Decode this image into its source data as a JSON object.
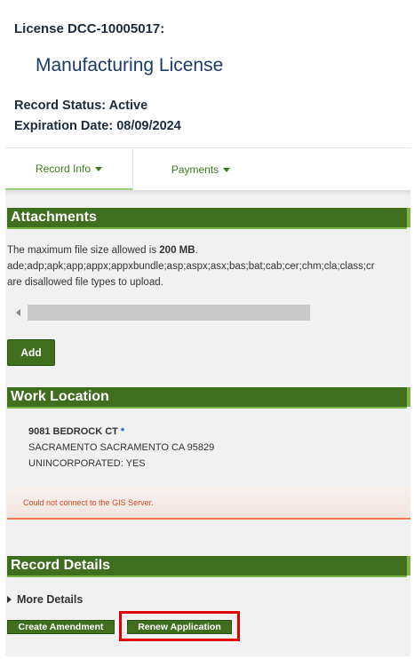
{
  "header": {
    "license_number": "License DCC-10005017:",
    "license_type": "Manufacturing License",
    "record_status": "Record Status: Active",
    "expiration_date": "Expiration Date: 08/09/2024"
  },
  "tabs": [
    {
      "label": "Record Info",
      "active": true
    },
    {
      "label": "Payments",
      "active": false
    }
  ],
  "attachments": {
    "title": "Attachments",
    "size_text_prefix": "The maximum file size allowed is ",
    "size_value": "200 MB",
    "size_text_suffix": ".",
    "file_types": "ade;adp;apk;app;appx;appxbundle;asp;aspx;asx;bas;bat;cab;cer;chm;cla;class;cr",
    "disallowed_note": "are disallowed file types to upload.",
    "add_label": "Add"
  },
  "work_location": {
    "title": "Work Location",
    "address_line1": "9081 BEDROCK CT",
    "required_mark": "*",
    "address_line2": "SACRAMENTO SACRAMENTO CA 95829",
    "address_line3": "UNINCORPORATED: YES",
    "gis_error": "Could not connect to the GIS Server."
  },
  "record_details": {
    "title": "Record Details",
    "more_details_label": "More Details",
    "create_amendment_label": "Create Amendment",
    "renew_application_label": "Renew Application"
  },
  "colors": {
    "section_green": "#3f6f1e",
    "section_accent": "#7ab648",
    "title_blue": "#1b3a6b",
    "error_orange": "#d34a1d",
    "highlight_red": "#e00000"
  }
}
